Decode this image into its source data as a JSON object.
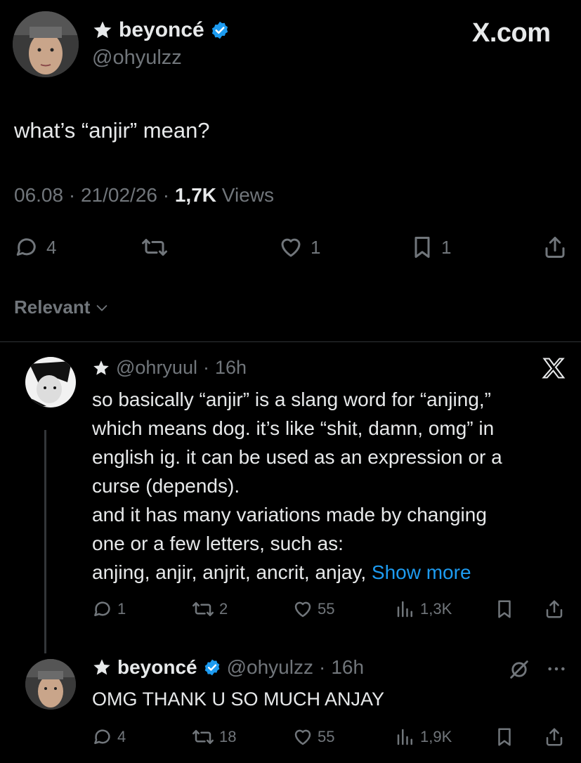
{
  "header": {
    "display_name": "beyoncé",
    "handle": "@ohyulzz",
    "watermark": "X.com"
  },
  "tweet": {
    "text": "what’s “anjir” mean?",
    "time": "06.08",
    "date": "21/02/26",
    "views_count": "1,7K",
    "views_label": "Views",
    "replies": "4",
    "reposts": "",
    "likes": "1",
    "bookmarks": "1"
  },
  "sort": {
    "label": "Relevant"
  },
  "reply": {
    "handle": "@ohryuul",
    "time": "16h",
    "body": "so basically “anjir” is a slang word for “anjing,”\nwhich means dog. it’s like “shit, damn, omg” in\nenglish ig. it can be used as an expression or a\ncurse (depends).\nand it has many variations made by changing\none or a few letters, such as:\nanjing, anjir, anjrit, ancrit, anjay, ",
    "show_more": "Show more",
    "replies": "1",
    "reposts": "2",
    "likes": "55",
    "views": "1,3K"
  },
  "self_reply": {
    "display_name": "beyoncé",
    "handle": "@ohyulzz",
    "time": "16h",
    "text": "OMG THANK U SO MUCH ANJAY",
    "replies": "4",
    "reposts": "18",
    "likes": "55",
    "views": "1,9K"
  },
  "colors": {
    "background": "#000000",
    "text": "#e7e9ea",
    "muted": "#71767b",
    "verified": "#1d9bf0",
    "show_more": "#1d9bf0"
  }
}
